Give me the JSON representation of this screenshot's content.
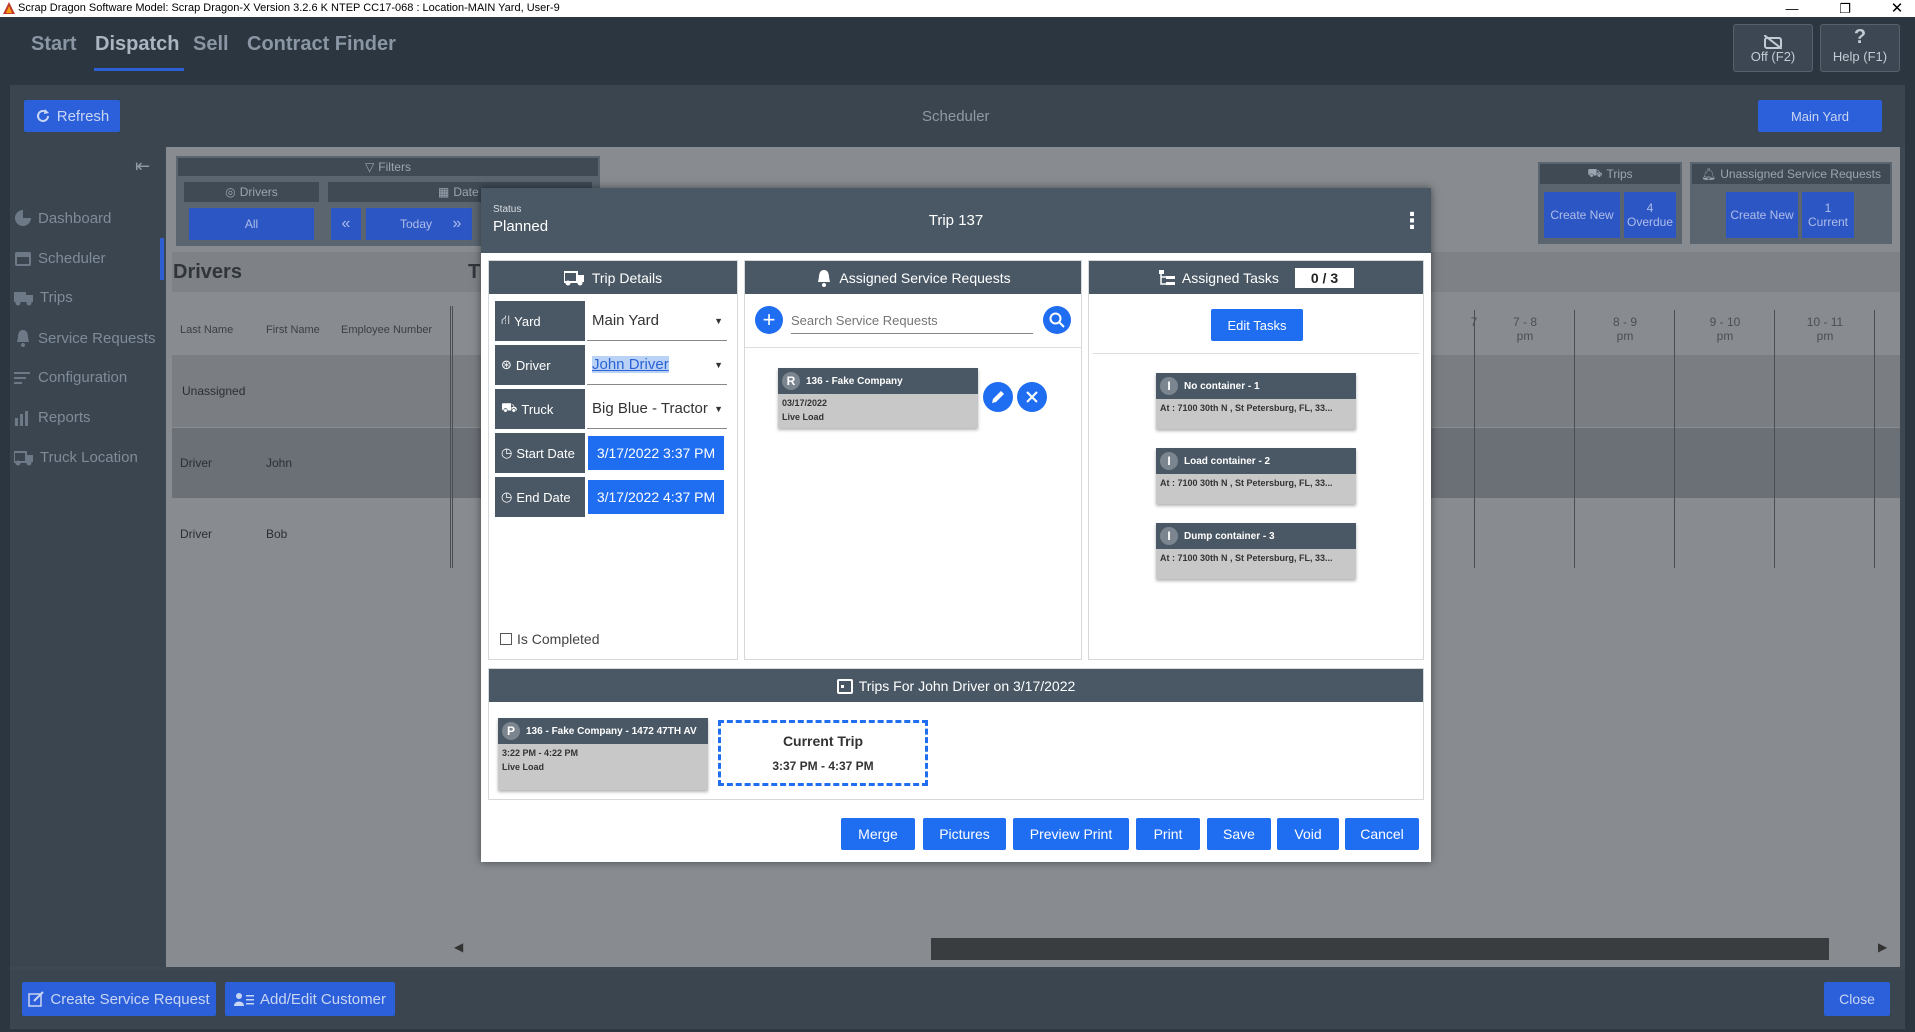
{
  "window": {
    "title": "Scrap Dragon Software Model: Scrap Dragon-X Version 3.2.6 K NTEP CC17-068 : Location-MAIN Yard, User-9"
  },
  "nav": {
    "items": [
      "Start",
      "Dispatch",
      "Sell",
      "Contract Finder"
    ],
    "active": "Dispatch"
  },
  "fkeys": {
    "off": "Off (F2)",
    "help": "Help (F1)"
  },
  "toolbar": {
    "refresh": "Refresh",
    "title": "Scheduler",
    "yard": "Main Yard"
  },
  "sidebar": {
    "items": [
      "Dashboard",
      "Scheduler",
      "Trips",
      "Service Requests",
      "Configuration",
      "Reports",
      "Truck Location"
    ]
  },
  "filters": {
    "title": "Filters",
    "drivers": "Drivers",
    "all": "All",
    "date": "Date",
    "today": "Today",
    "prev": "«",
    "next": "»"
  },
  "trips_panel": {
    "title": "Trips",
    "create_new": "Create New",
    "overdue_count": "4",
    "overdue_label": "Overdue"
  },
  "unassigned_panel": {
    "title": "Unassigned Service Requests",
    "create_new": "Create New",
    "current_count": "1",
    "current_label": "Current"
  },
  "drivers_table": {
    "title": "Drivers",
    "t_fragment": "T",
    "columns": [
      "Last Name",
      "First Name",
      "Employee Number"
    ],
    "rows": [
      {
        "last": "Unassigned",
        "first": ""
      },
      {
        "last": "Driver",
        "first": "John"
      },
      {
        "last": "Driver",
        "first": "Bob"
      }
    ]
  },
  "hours": [
    {
      "t": "7 - 8",
      "p": "pm"
    },
    {
      "t": "8 - 9",
      "p": "pm"
    },
    {
      "t": "9 - 10",
      "p": "pm"
    },
    {
      "t": "10 - 11",
      "p": "pm"
    }
  ],
  "hour_fragment": "7",
  "footer": {
    "create_sr": "Create Service Request",
    "add_edit_customer": "Add/Edit Customer",
    "close": "Close"
  },
  "modal": {
    "status_label": "Status",
    "status": "Planned",
    "title": "Trip 137",
    "menu": "⋮",
    "trip_details": {
      "header": "Trip Details",
      "yard_label": "Yard",
      "yard": "Main Yard",
      "driver_label": "Driver",
      "driver": "John Driver",
      "truck_label": "Truck",
      "truck": "Big Blue - Tractor",
      "start_label": "Start Date",
      "start": "3/17/2022 3:37 PM",
      "end_label": "End Date",
      "end": "3/17/2022 4:37 PM",
      "completed_label": "Is Completed"
    },
    "assigned_sr": {
      "header": "Assigned Service Requests",
      "search_placeholder": "Search Service Requests",
      "card": {
        "badge": "R",
        "title": "136 - Fake Company",
        "date": "03/17/2022",
        "type": "Live Load"
      }
    },
    "assigned_tasks": {
      "header": "Assigned Tasks",
      "count": "0 / 3",
      "edit": "Edit Tasks",
      "tasks": [
        {
          "badge": "I",
          "title": "No container - 1",
          "address": "At : 7100 30th N , St Petersburg, FL, 33..."
        },
        {
          "badge": "I",
          "title": "Load container - 2",
          "address": "At : 7100 30th N , St Petersburg, FL, 33..."
        },
        {
          "badge": "I",
          "title": "Dump container - 3",
          "address": "At : 7100 30th N , St Petersburg, FL, 33..."
        }
      ]
    },
    "trips_for": {
      "header": "Trips For John Driver on 3/17/2022",
      "card": {
        "badge": "P",
        "title": "136 - Fake Company - 1472 47TH AV",
        "time": "3:22 PM - 4:22 PM",
        "type": "Live Load"
      },
      "current": {
        "label": "Current Trip",
        "time": "3:37 PM - 4:37 PM"
      }
    },
    "actions": [
      "Merge",
      "Pictures",
      "Preview Print",
      "Print",
      "Save",
      "Void",
      "Cancel"
    ]
  },
  "colors": {
    "accent": "#1f6df0",
    "header": "#4a5865",
    "dark_bg": "#2b3641"
  }
}
